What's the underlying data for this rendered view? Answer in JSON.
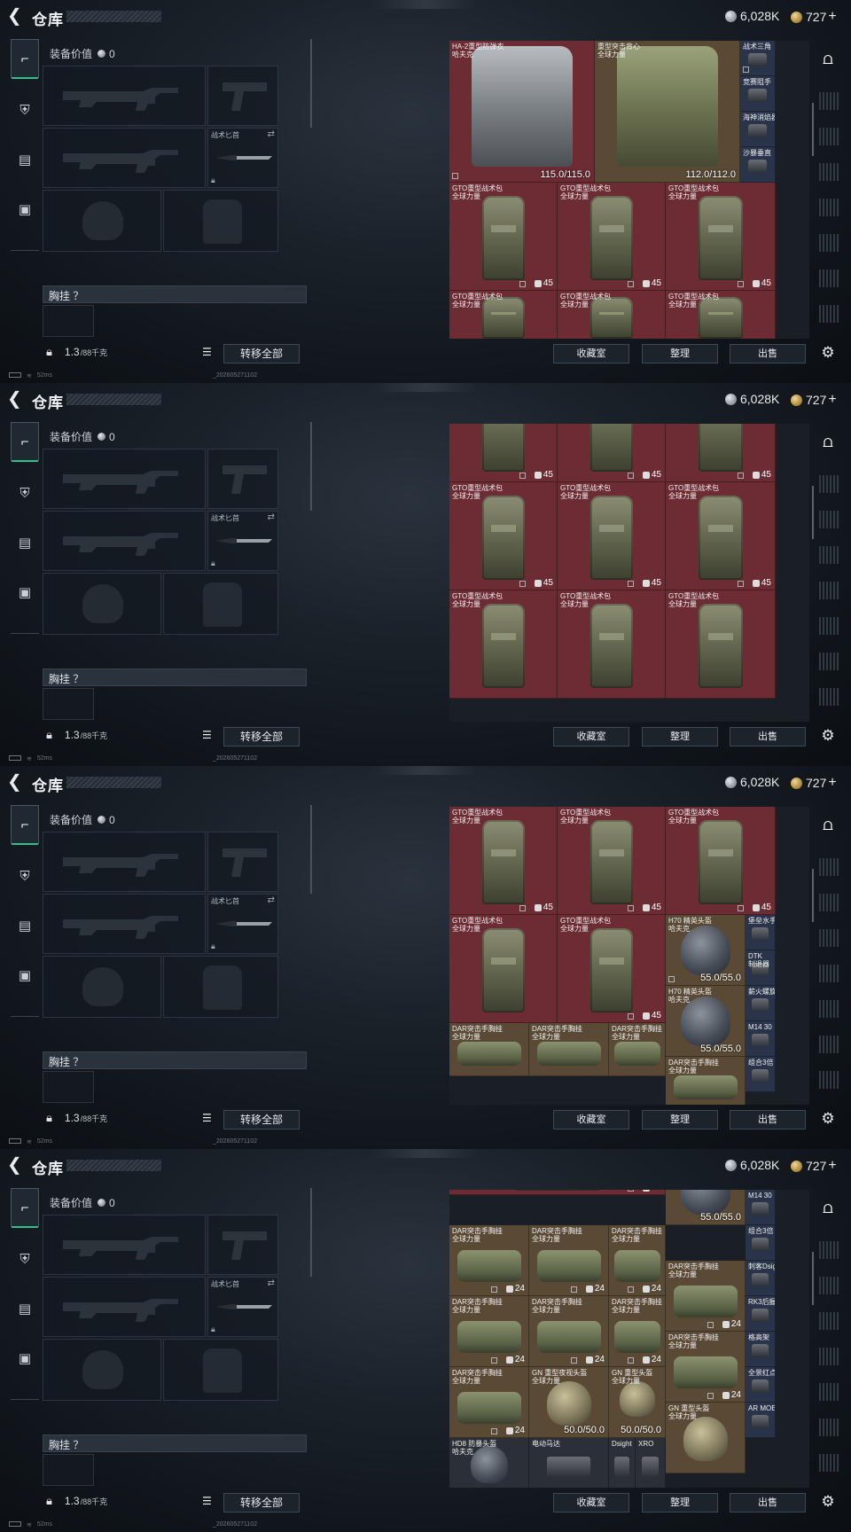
{
  "header": {
    "title": "仓库",
    "silver": "6,028K",
    "gold": "727",
    "gold_plus": "+"
  },
  "loadout": {
    "value_label": "装备价值",
    "value": "0",
    "knife_label": "战术匕首",
    "chest_label": "胸挂 ？",
    "weight": "1.3",
    "weight_unit": "/88千克",
    "transfer_all": "转移全部"
  },
  "stash_buttons": {
    "collection": "收藏室",
    "sort": "整理",
    "sell": "出售"
  },
  "status": {
    "ping": "52ms",
    "version": "_202605271102"
  },
  "items": {
    "vest_ha2": "HA-2重型防弹衣\n哈夫克",
    "vest_heavy": "重型突击背心\n全球力量",
    "gto": "GTO重型战术包\n全球力量",
    "dar": "DAR突击手胸挂\n全球力量",
    "h70": "H70 精英头盔\n哈夫克",
    "gn": "GN 重型夜视头盔\n全球力量",
    "gn2": "GN 重型头盔\n全球力量",
    "hd8": "HD8 防暴头盔\n哈夫克",
    "radio": "电动马达",
    "dsight": "Dsight",
    "xro": "XRO",
    "d1": "战术三角",
    "d2": "竞赛阻手",
    "d3": "海神消焰器",
    "d4": "沙暴垂直",
    "d5": "堡垒水手",
    "d6": "DTK\n制退器",
    "d7": "薪火螺旋...",
    "d8": "M14 30",
    "d9": "组合3倍",
    "d10": "刺客Dsig...",
    "d11": "RK3后握把",
    "d12": "格高架",
    "d13": "全景红点",
    "d14": "AR MOE...",
    "dur_115": "115.0/115.0",
    "dur_112": "112.0/112.0",
    "dur_55": "55.0/55.0",
    "dur_50": "50.0/50.0",
    "cnt_45": "45",
    "cnt_24": "24"
  }
}
